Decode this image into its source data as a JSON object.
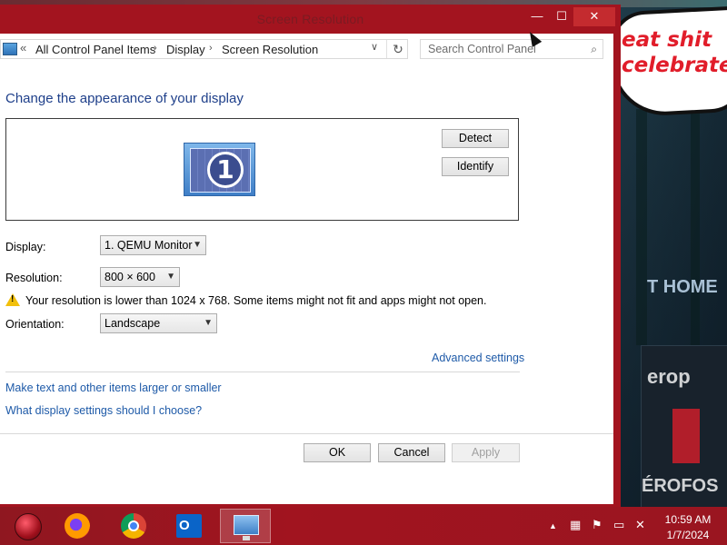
{
  "window": {
    "title": "Screen Resolution",
    "minimize_glyph": "—",
    "maximize_glyph": "☐",
    "close_glyph": "✕"
  },
  "address_bar": {
    "back_glyph": "«",
    "crumbs": [
      "All Control Panel Items",
      "Display",
      "Screen Resolution"
    ],
    "separator": "›",
    "dropdown_glyph": "∨",
    "refresh_glyph": "↻"
  },
  "search": {
    "placeholder": "Search Control Panel",
    "icon_glyph": "⌕"
  },
  "main": {
    "heading": "Change the appearance of your display",
    "monitor_number": "1",
    "detect_label": "Detect",
    "identify_label": "Identify",
    "display_label": "Display:",
    "display_value": "1. QEMU Monitor",
    "resolution_label": "Resolution:",
    "resolution_value": "800 × 600",
    "warning_text": "Your resolution is lower than 1024 x 768. Some items might not fit and apps might not open.",
    "orientation_label": "Orientation:",
    "orientation_value": "Landscape",
    "advanced_link": "Advanced settings",
    "link_text_size": "Make text and other items larger or smaller",
    "link_help": "What display settings should I choose?"
  },
  "footer": {
    "ok_label": "OK",
    "cancel_label": "Cancel",
    "apply_label": "Apply"
  },
  "desktop": {
    "speech_line1": "eat shit",
    "speech_line2": "celebrate",
    "sign_home": "T HOME",
    "sign_europe": "erop",
    "sign_aeros": "ÉROFOS"
  },
  "taskbar": {
    "outlook_letter": "O",
    "time": "10:59 AM",
    "date": "1/7/2024",
    "tray_chevron": "▲"
  },
  "colors": {
    "window_frame": "#a3141f",
    "close_button": "#c42b2f",
    "link": "#1e5aa8",
    "heading": "#1e3f8a",
    "taskbar": "#9a1520"
  }
}
